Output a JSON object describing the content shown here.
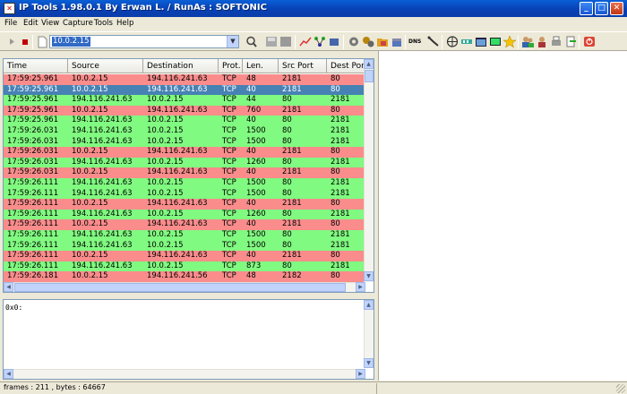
{
  "window": {
    "title": "IP Tools 1.98.0.1 By Erwan L. / RunAs : SOFTONIC",
    "icon": "ip-tools-app-icon"
  },
  "window_buttons": {
    "minimize": "_",
    "maximize": "□",
    "close": "✕"
  },
  "menu": [
    "File",
    "Edit",
    "View",
    "Capture",
    "Tools",
    "Help"
  ],
  "toolbar": {
    "ip_address": "10.0.2.15",
    "icons": [
      "play-icon",
      "stop-icon",
      "new-document-icon",
      "search-icon",
      "save-icon",
      "disk-icon",
      "graph-icon",
      "network-icon",
      "tools-icon",
      "settings-icon",
      "gears-icon",
      "folder-icon",
      "box-icon",
      "dns-icon",
      "cable-icon",
      "globe-icon",
      "adapter-icon",
      "window-icon",
      "monitor-icon",
      "star-icon",
      "users-icon",
      "group-icon",
      "printer-icon",
      "exit-icon",
      "power-icon"
    ],
    "dns_label": "DNS"
  },
  "table": {
    "columns": [
      "Time",
      "Source",
      "Destination",
      "Prot.",
      "Len.",
      "Src Port",
      "Dest Port"
    ],
    "rows": [
      {
        "time": "17:59:25.961",
        "src": "10.0.2.15",
        "dst": "194.116.241.63",
        "prot": "TCP",
        "len": "48",
        "sport": "2181",
        "dport": "80",
        "color": "red"
      },
      {
        "time": "17:59:25.961",
        "src": "10.0.2.15",
        "dst": "194.116.241.63",
        "prot": "TCP",
        "len": "40",
        "sport": "2181",
        "dport": "80",
        "color": "selected"
      },
      {
        "time": "17:59:25.961",
        "src": "194.116.241.63",
        "dst": "10.0.2.15",
        "prot": "TCP",
        "len": "44",
        "sport": "80",
        "dport": "2181",
        "color": "green"
      },
      {
        "time": "17:59:25.961",
        "src": "10.0.2.15",
        "dst": "194.116.241.63",
        "prot": "TCP",
        "len": "760",
        "sport": "2181",
        "dport": "80",
        "color": "red"
      },
      {
        "time": "17:59:25.961",
        "src": "194.116.241.63",
        "dst": "10.0.2.15",
        "prot": "TCP",
        "len": "40",
        "sport": "80",
        "dport": "2181",
        "color": "green"
      },
      {
        "time": "17:59:26.031",
        "src": "194.116.241.63",
        "dst": "10.0.2.15",
        "prot": "TCP",
        "len": "1500",
        "sport": "80",
        "dport": "2181",
        "color": "green"
      },
      {
        "time": "17:59:26.031",
        "src": "194.116.241.63",
        "dst": "10.0.2.15",
        "prot": "TCP",
        "len": "1500",
        "sport": "80",
        "dport": "2181",
        "color": "green"
      },
      {
        "time": "17:59:26.031",
        "src": "10.0.2.15",
        "dst": "194.116.241.63",
        "prot": "TCP",
        "len": "40",
        "sport": "2181",
        "dport": "80",
        "color": "red"
      },
      {
        "time": "17:59:26.031",
        "src": "194.116.241.63",
        "dst": "10.0.2.15",
        "prot": "TCP",
        "len": "1260",
        "sport": "80",
        "dport": "2181",
        "color": "green"
      },
      {
        "time": "17:59:26.031",
        "src": "10.0.2.15",
        "dst": "194.116.241.63",
        "prot": "TCP",
        "len": "40",
        "sport": "2181",
        "dport": "80",
        "color": "red"
      },
      {
        "time": "17:59:26.111",
        "src": "194.116.241.63",
        "dst": "10.0.2.15",
        "prot": "TCP",
        "len": "1500",
        "sport": "80",
        "dport": "2181",
        "color": "green"
      },
      {
        "time": "17:59:26.111",
        "src": "194.116.241.63",
        "dst": "10.0.2.15",
        "prot": "TCP",
        "len": "1500",
        "sport": "80",
        "dport": "2181",
        "color": "green"
      },
      {
        "time": "17:59:26.111",
        "src": "10.0.2.15",
        "dst": "194.116.241.63",
        "prot": "TCP",
        "len": "40",
        "sport": "2181",
        "dport": "80",
        "color": "red"
      },
      {
        "time": "17:59:26.111",
        "src": "194.116.241.63",
        "dst": "10.0.2.15",
        "prot": "TCP",
        "len": "1260",
        "sport": "80",
        "dport": "2181",
        "color": "green"
      },
      {
        "time": "17:59:26.111",
        "src": "10.0.2.15",
        "dst": "194.116.241.63",
        "prot": "TCP",
        "len": "40",
        "sport": "2181",
        "dport": "80",
        "color": "red"
      },
      {
        "time": "17:59:26.111",
        "src": "194.116.241.63",
        "dst": "10.0.2.15",
        "prot": "TCP",
        "len": "1500",
        "sport": "80",
        "dport": "2181",
        "color": "green"
      },
      {
        "time": "17:59:26.111",
        "src": "194.116.241.63",
        "dst": "10.0.2.15",
        "prot": "TCP",
        "len": "1500",
        "sport": "80",
        "dport": "2181",
        "color": "green"
      },
      {
        "time": "17:59:26.111",
        "src": "10.0.2.15",
        "dst": "194.116.241.63",
        "prot": "TCP",
        "len": "40",
        "sport": "2181",
        "dport": "80",
        "color": "red"
      },
      {
        "time": "17:59:26.111",
        "src": "194.116.241.63",
        "dst": "10.0.2.15",
        "prot": "TCP",
        "len": "873",
        "sport": "80",
        "dport": "2181",
        "color": "green"
      },
      {
        "time": "17:59:26.181",
        "src": "10.0.2.15",
        "dst": "194.116.241.56",
        "prot": "TCP",
        "len": "48",
        "sport": "2182",
        "dport": "80",
        "color": "red"
      }
    ]
  },
  "hex_pane": {
    "text": "0x0:"
  },
  "status": {
    "text": "frames : 211 , bytes : 64667"
  },
  "colors": {
    "red_row": "#fa8c8c",
    "green_row": "#80fa80",
    "selected_row": "#4682b4",
    "titlebar": "#0a5fd6"
  }
}
